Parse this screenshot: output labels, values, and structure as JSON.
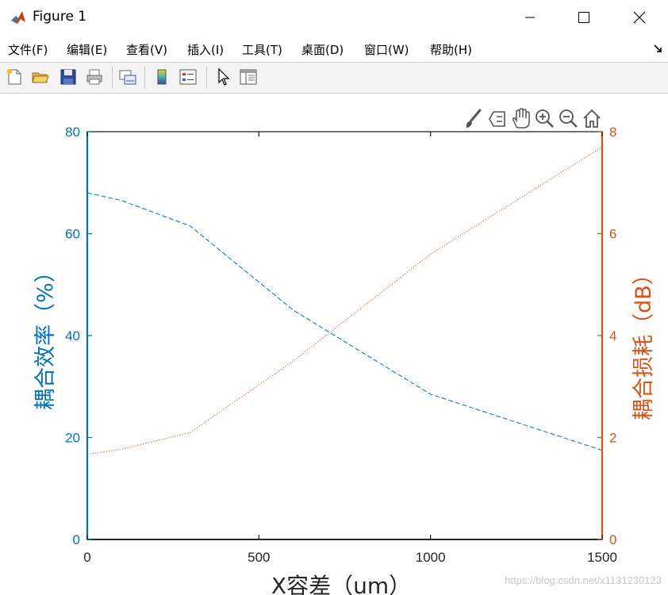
{
  "window": {
    "title": "Figure 1"
  },
  "menu": [
    "文件(F)",
    "编辑(E)",
    "查看(V)",
    "插入(I)",
    "工具(T)",
    "桌面(D)",
    "窗口(W)",
    "帮助(H)"
  ],
  "toolbar_icons": [
    "new-figure-icon",
    "open-file-icon",
    "save-icon",
    "print-icon",
    "link-plot-icon",
    "colorbar-icon",
    "legend-icon",
    "edit-plot-icon",
    "property-inspector-icon"
  ],
  "axes_toolbar_icons": [
    "brush-icon",
    "data-tips-icon",
    "pan-icon",
    "zoom-in-icon",
    "zoom-out-icon",
    "home-icon"
  ],
  "colors": {
    "left": "#0072BD",
    "right": "#D95319",
    "axis": "#262626"
  },
  "watermark": "https://blog.csdn.net/x1131230123",
  "chart_data": {
    "type": "line",
    "xlabel": "X容差（um）",
    "ylabel_left": "耦合效率（%）",
    "ylabel_right": "耦合损耗（dB）",
    "xlim": [
      0,
      1500
    ],
    "ylim_left": [
      0,
      80
    ],
    "ylim_right": [
      0,
      8
    ],
    "xticks": [
      "0",
      "500",
      "1000",
      "1500"
    ],
    "yticks_left": [
      "0",
      "20",
      "40",
      "60",
      "80"
    ],
    "yticks_right": [
      "0",
      "2",
      "4",
      "6",
      "8"
    ],
    "grid": false,
    "series": [
      {
        "axis": "left",
        "style": "dashed",
        "x": [
          0,
          100,
          300,
          600,
          1000,
          1500
        ],
        "y": [
          68,
          66.5,
          61.5,
          45,
          28.5,
          17.5
        ]
      },
      {
        "axis": "right",
        "style": "dotted",
        "x": [
          0,
          100,
          300,
          600,
          1000,
          1500
        ],
        "y": [
          1.67,
          1.77,
          2.1,
          3.5,
          5.6,
          7.7
        ]
      }
    ]
  }
}
